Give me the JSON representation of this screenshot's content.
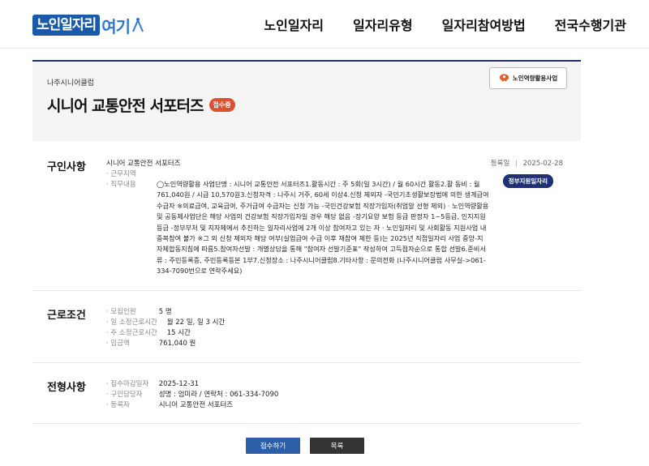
{
  "header": {
    "logo_main": "노인일자리",
    "logo_tail": "여기",
    "nav": [
      "노인일자리",
      "일자리유형",
      "일자리참여방법",
      "전국수행기관"
    ]
  },
  "job": {
    "org": "나주시니어클럽",
    "title": "시니어 교통안전 서포터즈",
    "status": "접수중",
    "program_badge": "노인역량활용사업"
  },
  "recruit": {
    "section_title": "구인사항",
    "recruit_title": "시니어 교통안전 서포터즈",
    "reg_label": "등록일",
    "reg_sep": "|",
    "reg_date": "2025-02-28",
    "gov_badge": "정부지원일자리",
    "rows": [
      {
        "label": "· 근무지역",
        "value": ""
      },
      {
        "label": "· 직무내용",
        "value": ""
      }
    ],
    "duty": "◯노인역량활용 사업단명 : 시니어 교통안전 서포터즈1.활동시간 : 주 5회(일 3시간) / 월 60시간 활동2.활 동비 : 월 761,040원 / 시급 10,570원3.신청자격 : 나주시 거주, 60세 이상4.신청 제외자  -국민기초생활보장법에 의한 생계급여 수급자 ※의료급여, 교육급여, 주거급여 수급자는 신청 가능  -국민건강보험 직장가입자(취업알 선형 제외)  · 노인역량활용 및 공동체사업단은 해당 사업의 건강보험 직장가입자일 경우 해당 없음  -장기요양 보험 등급 판정자 1~5등급, 인지지원등급  -정부부처 및 지자체에서 추진하는 일자리사업에 2개 이상 참여자고 있는 자 · 노인일자리 및 사회활동 지원사업 내 중복참여 불가 ※그 외 신청 제외자 해당 여부(실업급여 수급 이후 재참여 제한 등)는 2025년 직접일자리 사업 중앙-지자체합동지침에 따름5.참여자선발 : 개별상담을 통해 \"참여자 선발기준표\" 작성하여 고득점자순으로 통합 선발6.준비서류 : 주민등록증, 주민등록등본 1부7.신청장소 : 나주시니어클럽8.기타사항 : 문의전화 (나주시니어클럽 사무실->061-334-7090번으로 연락주세요)"
  },
  "conditions": {
    "section_title": "근로조건",
    "rows": [
      {
        "label": "· 모집인원",
        "value": "5 명"
      },
      {
        "label": "· 일 소정근로시간",
        "value": "월 22 일, 일 3 시간"
      },
      {
        "label": "· 주 소정근로시간",
        "value": "15 시간"
      },
      {
        "label": "· 임금액",
        "value": "761,040 원"
      }
    ]
  },
  "selection": {
    "section_title": "전형사항",
    "rows": [
      {
        "label": "· 접수마감일자",
        "value": "2025-12-31"
      },
      {
        "label": "· 구인담당자",
        "value": "성명 : 엄미라 / 연락처 : 061-334-7090"
      },
      {
        "label": "· 등록자",
        "value": "시니어 교통안전 서포터즈"
      }
    ]
  },
  "buttons": {
    "apply": "접수하기",
    "list": "목록"
  },
  "colors": {
    "brand_blue": "#1a5aa8",
    "navy": "#1f2f6b",
    "status_orange": "#d9522d",
    "apply_blue": "#2d5fa8",
    "list_dark": "#333333"
  }
}
